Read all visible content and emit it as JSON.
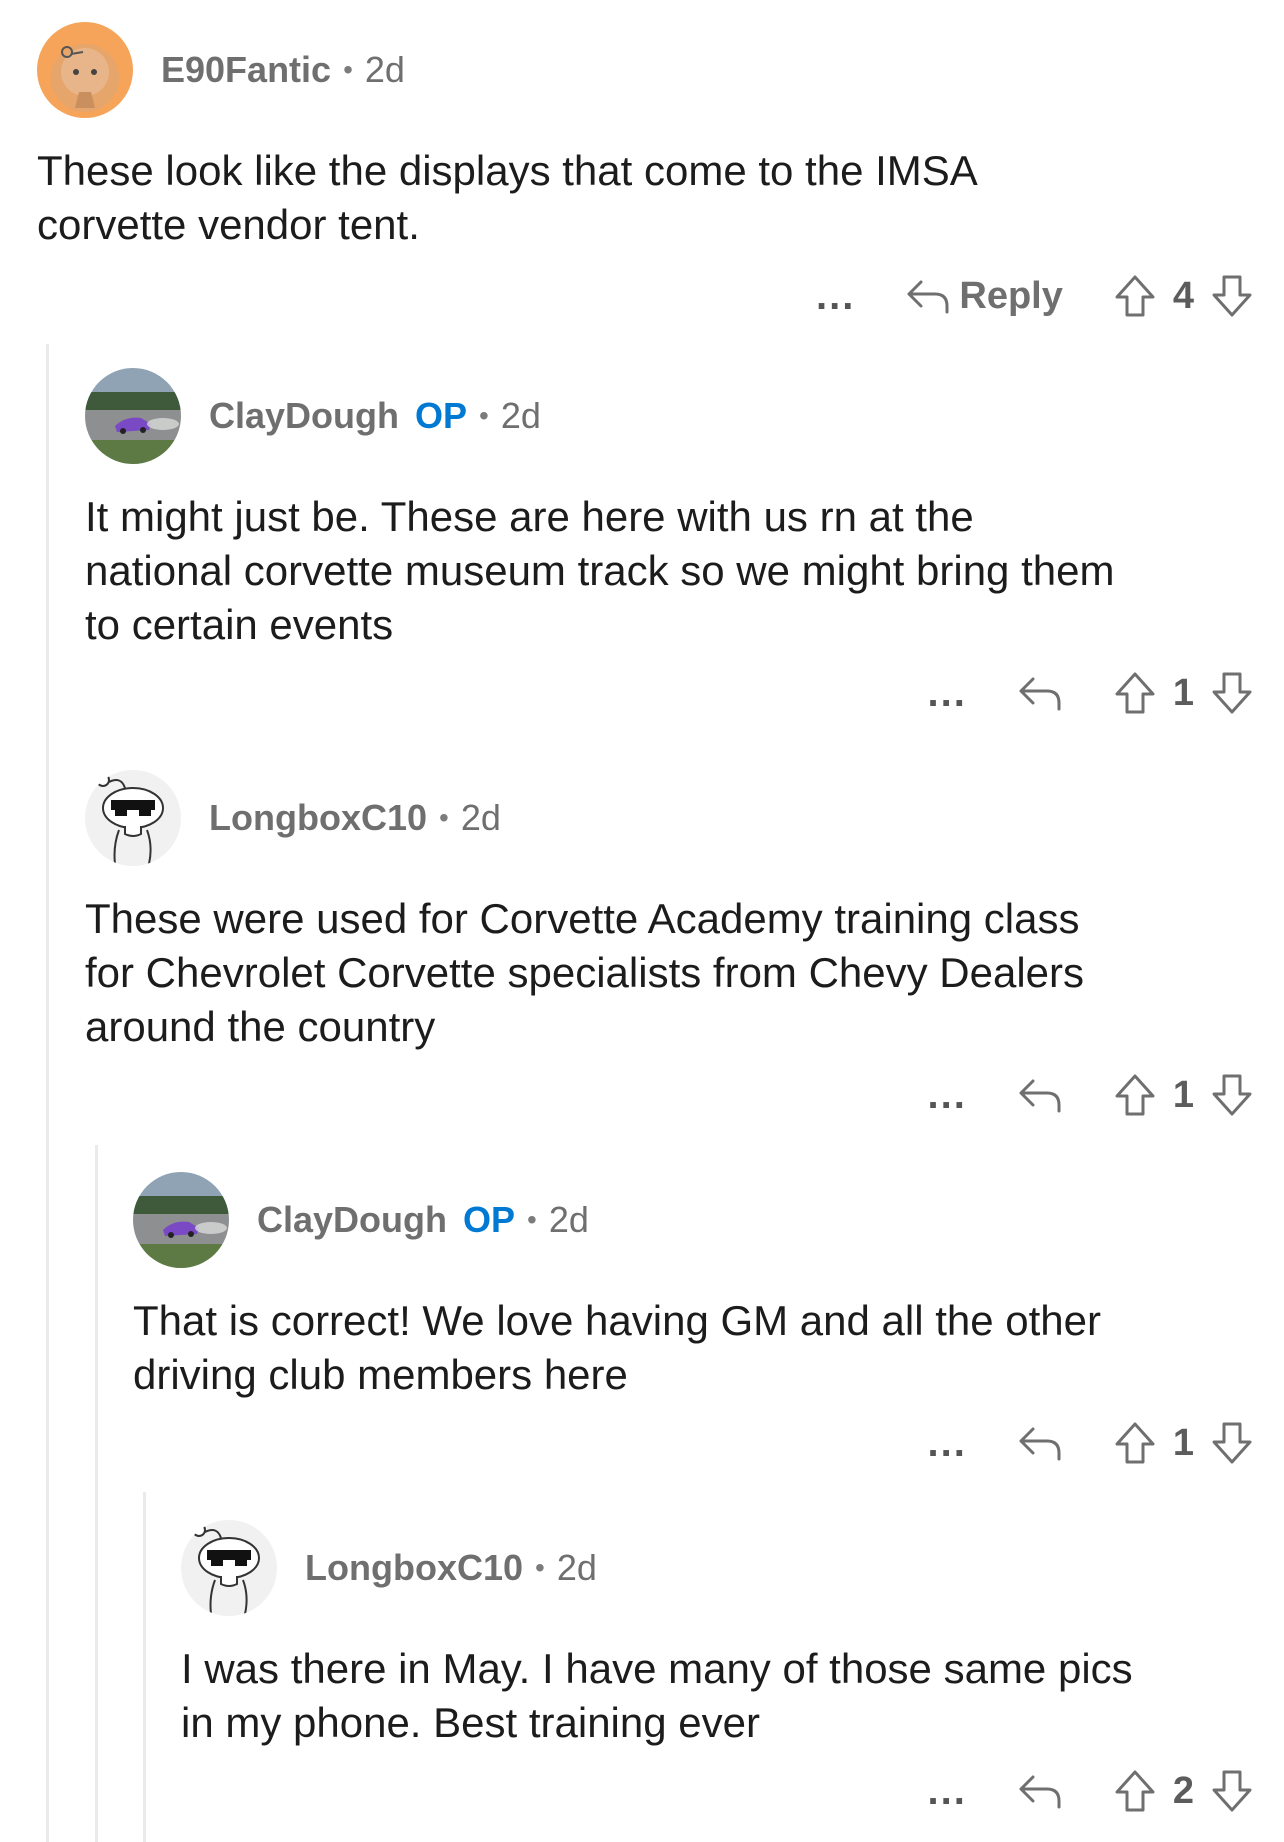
{
  "comments": [
    {
      "author": "E90Fantic",
      "op_label": "",
      "time": "2d",
      "body": "These look like the displays that come to the IMSA\ncorvette vendor tent.",
      "more_icon": "...",
      "reply_label": "Reply",
      "votes": "4",
      "avatar": "orange-snoo-avatar"
    },
    {
      "author": "ClayDough",
      "op_label": "OP",
      "time": "2d",
      "body": "It might just be. These are here with us rn at the\nnational corvette museum track so we might bring them\nto certain events",
      "more_icon": "...",
      "votes": "1",
      "avatar": "purple-corvette-photo-avatar"
    },
    {
      "author": "LongboxC10",
      "op_label": "",
      "time": "2d",
      "body": "These were used for Corvette Academy training class\nfor Chevrolet Corvette specialists from Chevy Dealers\naround the country",
      "more_icon": "...",
      "votes": "1",
      "avatar": "snoo-sunglasses-avatar"
    },
    {
      "author": "ClayDough",
      "op_label": "OP",
      "time": "2d",
      "body": "That is correct! We love having GM and all the other\ndriving club members here",
      "more_icon": "...",
      "votes": "1",
      "avatar": "purple-corvette-photo-avatar"
    },
    {
      "author": "LongboxC10",
      "op_label": "",
      "time": "2d",
      "body": "I was there in May. I have many of those same pics\nin my phone. Best training ever",
      "more_icon": "...",
      "votes": "2",
      "avatar": "snoo-sunglasses-avatar"
    }
  ],
  "colors": {
    "op_blue": "#0079d3",
    "thread_line": "#e9eaeb",
    "orange_avatar": "#f6a45a"
  }
}
